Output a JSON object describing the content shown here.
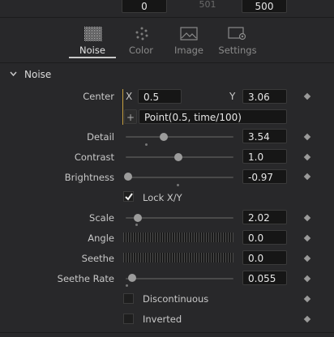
{
  "top_fields": {
    "left": "0",
    "middle": "501",
    "right": "500"
  },
  "tabs": [
    {
      "label": "Noise",
      "icon": "noise-icon",
      "active": true
    },
    {
      "label": "Color",
      "icon": "color-dots-icon",
      "active": false
    },
    {
      "label": "Image",
      "icon": "image-icon",
      "active": false
    },
    {
      "label": "Settings",
      "icon": "settings-icon",
      "active": false
    }
  ],
  "section": {
    "title": "Noise",
    "icon": "chevron-down-icon"
  },
  "center": {
    "label": "Center",
    "x_label": "X",
    "x_value": "0.5",
    "y_label": "Y",
    "y_value": "3.06",
    "expression_button": "+",
    "expression": "Point(0.5, time/100)"
  },
  "params": {
    "detail": {
      "label": "Detail",
      "value": "3.54",
      "level": 0.35
    },
    "contrast": {
      "label": "Contrast",
      "value": "1.0",
      "level": 0.49
    },
    "brightness": {
      "label": "Brightness",
      "value": "-0.97",
      "level": 0.0
    },
    "lock_xy": {
      "label": "Lock X/Y",
      "checked": true
    },
    "scale": {
      "label": "Scale",
      "value": "2.02",
      "level": 0.1
    },
    "angle": {
      "label": "Angle",
      "value": "0.0"
    },
    "seethe": {
      "label": "Seethe",
      "value": "0.0"
    },
    "seethe_rate": {
      "label": "Seethe Rate",
      "value": "0.055",
      "level": 0.03
    },
    "discontinuous": {
      "label": "Discontinuous",
      "checked": false
    },
    "inverted": {
      "label": "Inverted",
      "checked": false
    }
  },
  "colors": {
    "accent_bar": "#c8a040",
    "active_tab_underline": "#c8c8c8"
  }
}
